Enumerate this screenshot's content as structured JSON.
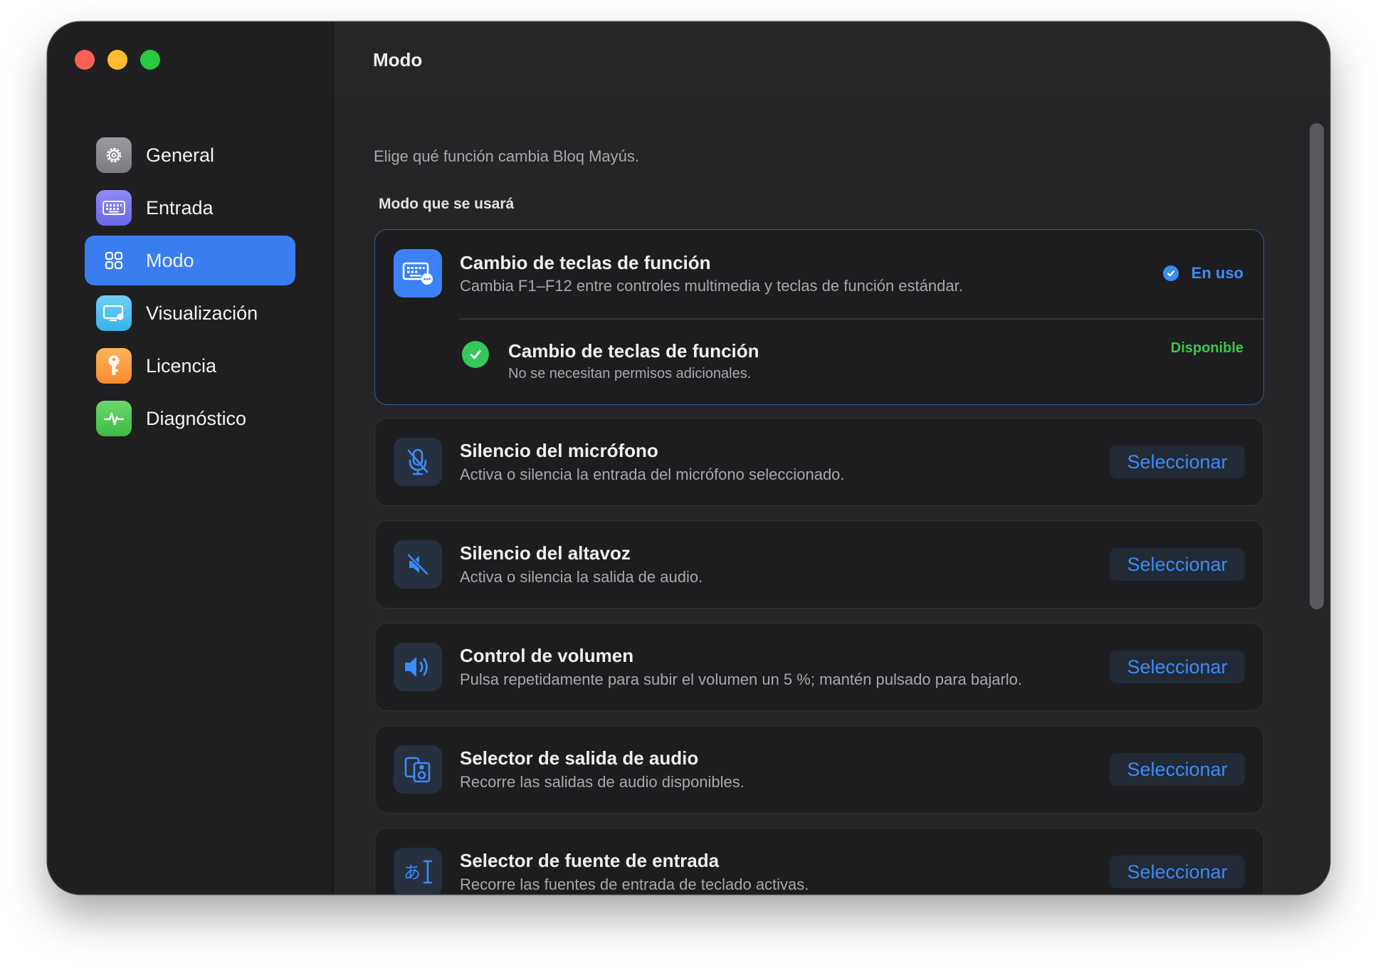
{
  "window": {
    "title": "Modo"
  },
  "sidebar": {
    "items": [
      {
        "label": "General",
        "icon": "gear-icon"
      },
      {
        "label": "Entrada",
        "icon": "keyboard-icon"
      },
      {
        "label": "Modo",
        "icon": "grid-icon",
        "active": true
      },
      {
        "label": "Visualización",
        "icon": "display-icon"
      },
      {
        "label": "Licencia",
        "icon": "key-icon"
      },
      {
        "label": "Diagnóstico",
        "icon": "pulse-icon"
      }
    ]
  },
  "main": {
    "description": "Elige qué función cambia Bloq Mayús.",
    "section_label": "Modo que se usará",
    "selected": {
      "title": "Cambio de teclas de función",
      "subtitle": "Cambia F1–F12 entre controles multimedia y teclas de función estándar.",
      "status": "En uso",
      "requirement_title": "Cambio de teclas de función",
      "requirement_subtitle": "No se necesitan permisos adicionales.",
      "requirement_status": "Disponible"
    },
    "modes": [
      {
        "title": "Silencio del micrófono",
        "subtitle": "Activa o silencia la entrada del micrófono seleccionado.",
        "button": "Seleccionar",
        "icon": "mic-slash-icon"
      },
      {
        "title": "Silencio del altavoz",
        "subtitle": "Activa o silencia la salida de audio.",
        "button": "Seleccionar",
        "icon": "speaker-slash-icon"
      },
      {
        "title": "Control de volumen",
        "subtitle": "Pulsa repetidamente para subir el volumen un 5 %; mantén pulsado para bajarlo.",
        "button": "Seleccionar",
        "icon": "speaker-wave-icon"
      },
      {
        "title": "Selector de salida de audio",
        "subtitle": "Recorre las salidas de audio disponibles.",
        "button": "Seleccionar",
        "icon": "speakers-icon"
      },
      {
        "title": "Selector de fuente de entrada",
        "subtitle": "Recorre las fuentes de entrada de teclado activas.",
        "button": "Seleccionar",
        "icon": "input-source-icon"
      }
    ]
  },
  "colors": {
    "accent": "#3a7df0",
    "link": "#3b8cf5",
    "available": "#3ec54a",
    "background": "#232325"
  }
}
